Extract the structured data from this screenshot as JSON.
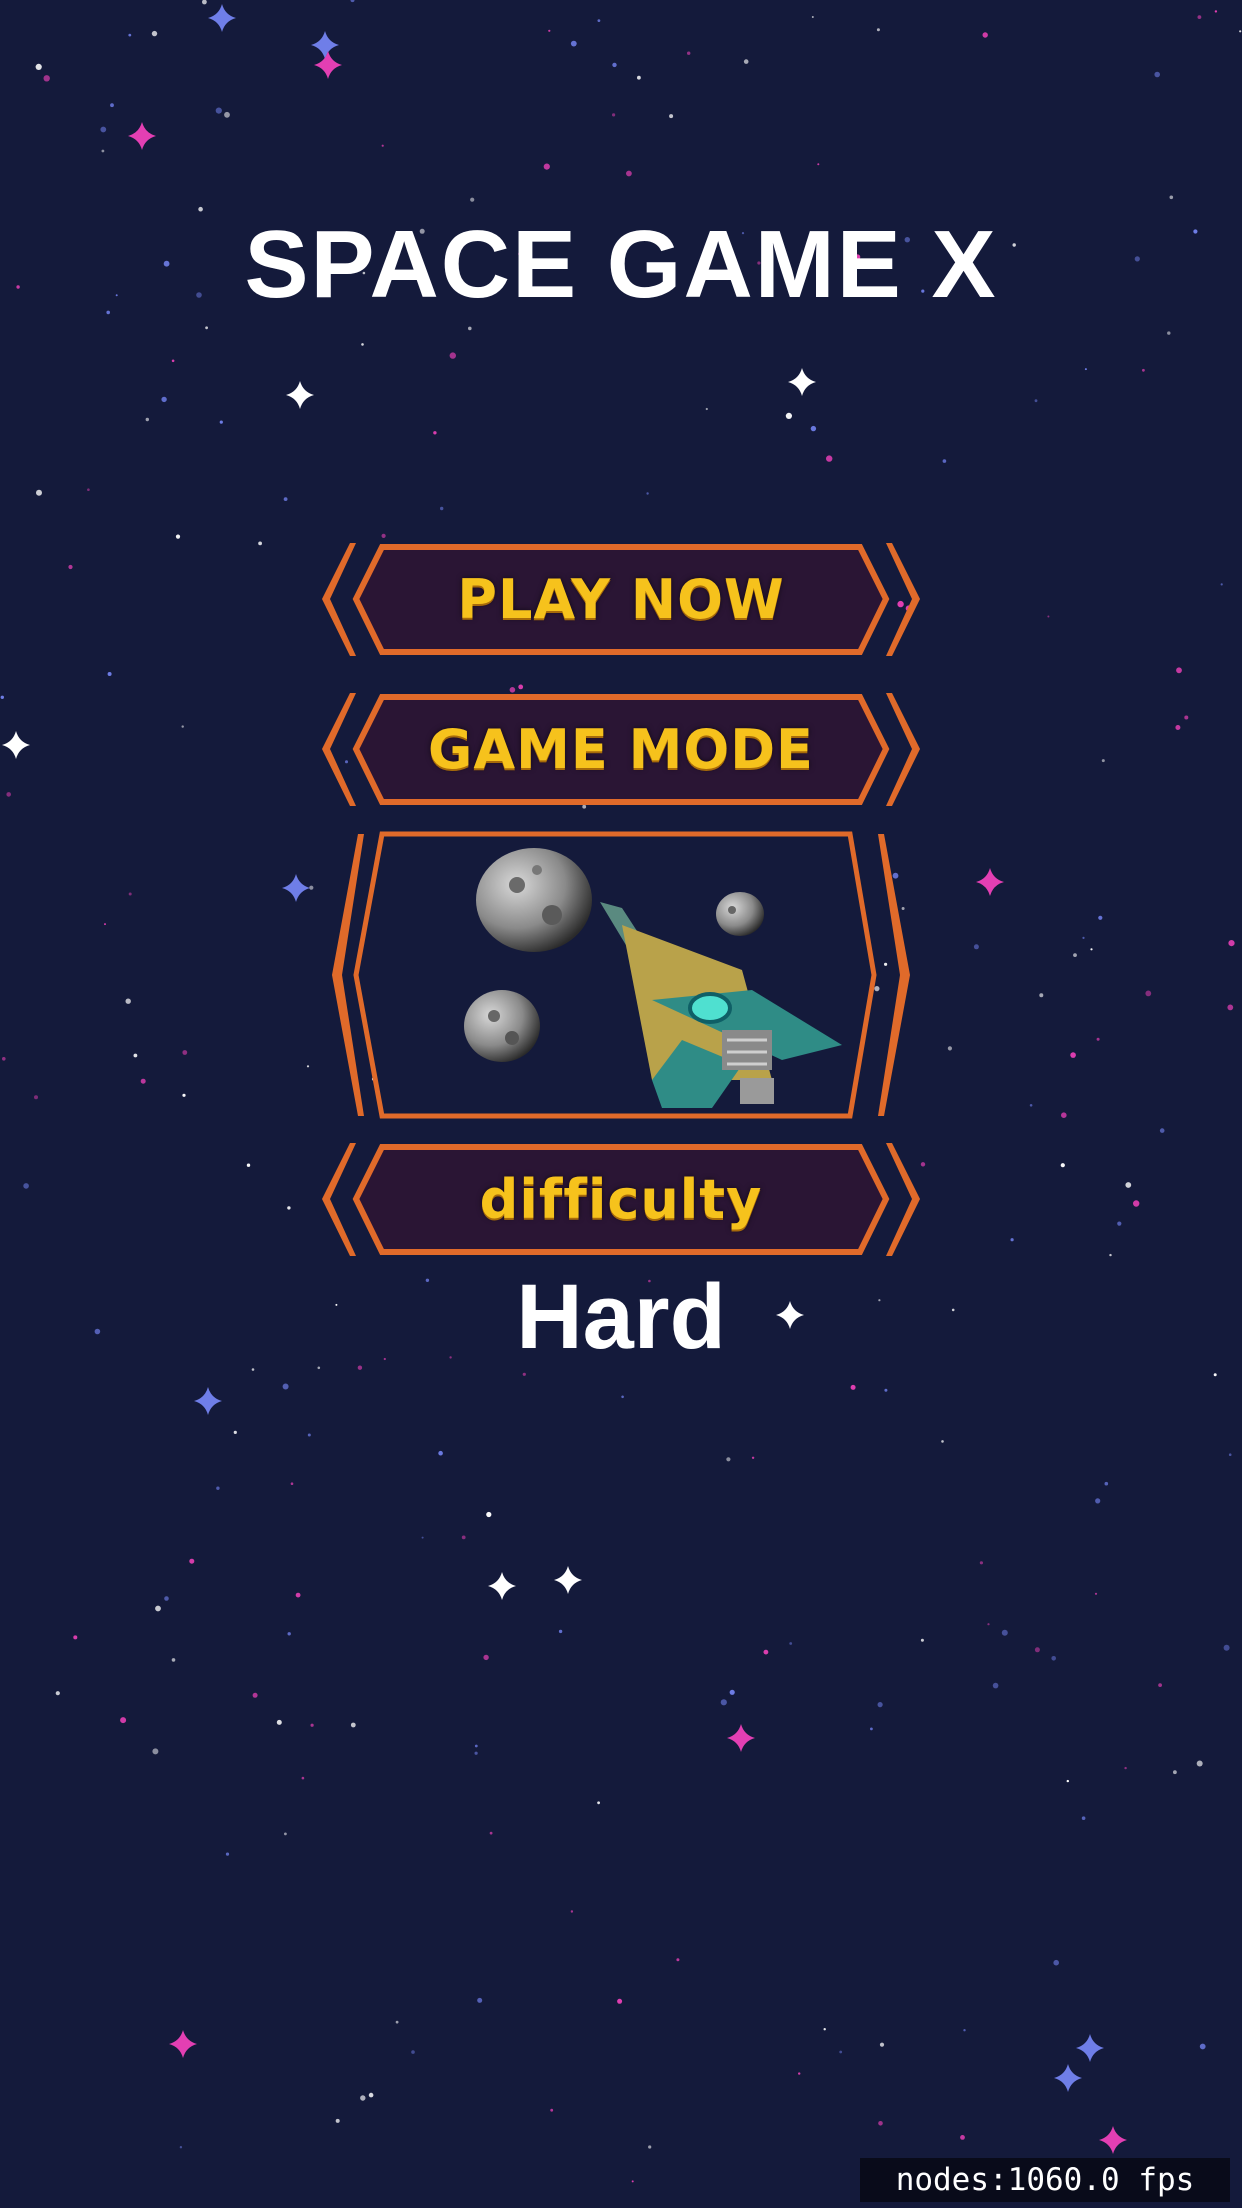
{
  "game": {
    "title": "SPACE GAME X"
  },
  "menu": {
    "play_label": "PLAY NOW",
    "mode_label": "GAME MODE",
    "difficulty_label": "difficulty",
    "difficulty_value": "Hard"
  },
  "debug": {
    "nodes_label": "nodes:10",
    "fps_label": "60.0 fps"
  },
  "colors": {
    "background": "#141a3b",
    "button_border": "#e06a2a",
    "button_fill": "#2a1534",
    "button_text": "#f6c21c",
    "star_white": "#ffffff",
    "star_pink": "#e33fb3",
    "star_blue": "#6f7ee8"
  },
  "icons": {
    "preview": "ship-and-asteroids-preview",
    "star": "four-point-star-icon"
  }
}
